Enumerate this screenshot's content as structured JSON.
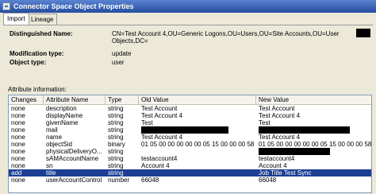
{
  "window": {
    "title": "Connector Space Object Properties"
  },
  "tabs": [
    {
      "label": "Import",
      "active": true
    },
    {
      "label": "Lineage",
      "active": false
    }
  ],
  "fields": {
    "dn_label": "Distinguished Name:",
    "dn_value": "CN=Test Account 4,OU=Generic Logons,OU=Users,OU=Site Accounts,OU=User Objects,DC=",
    "mod_label": "Modification type:",
    "mod_value": "update",
    "objtype_label": "Object type:",
    "objtype_value": "user"
  },
  "attribute_info_label": "Attribute information:",
  "table": {
    "columns": [
      "Changes",
      "Attribute Name",
      "Type",
      "Old Value",
      "New Value"
    ],
    "rows": [
      [
        "none",
        "description",
        "string",
        "Test Account",
        "Test Account"
      ],
      [
        "none",
        "displayName",
        "string",
        "Test Account 4",
        "Test Account 4"
      ],
      [
        "none",
        "givenName",
        "string",
        "Test",
        "Test"
      ],
      [
        "none",
        "mail",
        "string",
        "",
        ""
      ],
      [
        "none",
        "name",
        "string",
        "Test Account 4",
        "Test Account 4"
      ],
      [
        "none",
        "objectSid",
        "binary",
        "01 05 00 00 00 00 00 05 15 00 00 00 58 2...",
        "01 05 00 00 00 00 00 05 15 00 00 00 58 2..."
      ],
      [
        "none",
        "physicalDeliveryO...",
        "string",
        "",
        ""
      ],
      [
        "none",
        "sAMAccountName",
        "string",
        "testaccount4",
        "testaccount4"
      ],
      [
        "none",
        "sn",
        "string",
        "Account 4",
        "Account 4"
      ],
      [
        "add",
        "title",
        "string",
        "",
        "Job Title Test Sync"
      ],
      [
        "none",
        "userAccountControl",
        "number",
        "66048",
        "66048"
      ]
    ],
    "selected_row": 9
  },
  "colors": {
    "title_bar": "#244c9e",
    "selection": "#1c3f94",
    "dialog_bg": "#ece9d8"
  }
}
